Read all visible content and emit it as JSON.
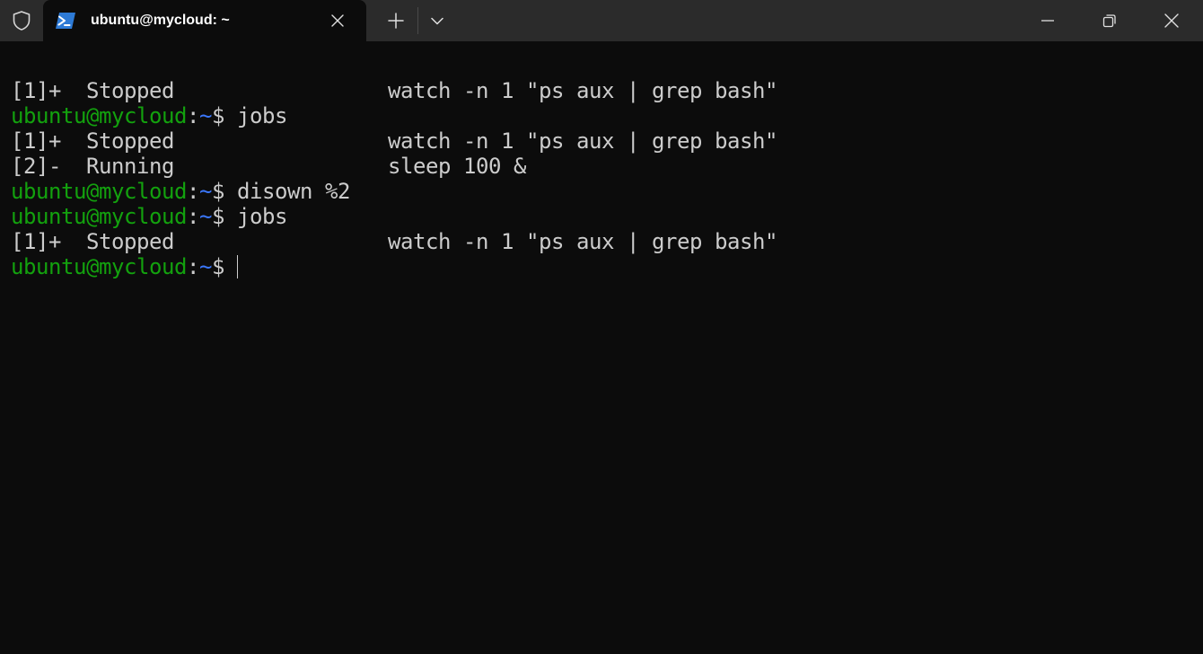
{
  "titlebar": {
    "shield_icon": "shield-icon",
    "tab": {
      "icon": "powershell-icon",
      "title": "ubuntu@mycloud: ~",
      "close_icon": "close-icon"
    },
    "new_tab_icon": "plus-icon",
    "dropdown_icon": "chevron-down-icon",
    "window_controls": [
      "minimize-icon",
      "restore-icon",
      "close-icon"
    ]
  },
  "colors": {
    "terminal_bg": "#0c0c0c",
    "titlebar_bg": "#2b2b2b",
    "text": "#cccccc",
    "prompt_user": "#13a10e",
    "prompt_path": "#3b78ff"
  },
  "terminal": {
    "prompt": {
      "user": "ubuntu@mycloud",
      "colon": ":",
      "path": "~",
      "dollar": "$ "
    },
    "lines": {
      "l1": {
        "job": "[1]+  Stopped",
        "cmd": "watch -n 1 \"ps aux | grep bash\""
      },
      "l2": {
        "cmd": "jobs"
      },
      "l3": {
        "job": "[1]+  Stopped",
        "cmd": "watch -n 1 \"ps aux | grep bash\""
      },
      "l4": {
        "job": "[2]-  Running",
        "cmd": "sleep 100 &"
      },
      "l5": {
        "cmd": "disown %2"
      },
      "l6": {
        "cmd": "jobs"
      },
      "l7": {
        "job": "[1]+  Stopped",
        "cmd": "watch -n 1 \"ps aux | grep bash\""
      },
      "l8": {
        "cmd": ""
      }
    }
  }
}
